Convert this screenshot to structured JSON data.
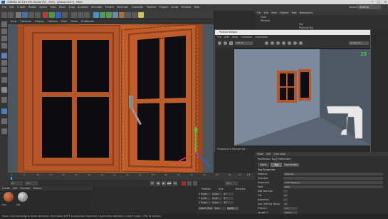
{
  "window": {
    "title": "CINEMA 4D R19.053 Studio (RC - R19) - [Szene.c4d *] - Main",
    "min": "—",
    "max": "▢",
    "close": "✕"
  },
  "menu": {
    "items": [
      "File",
      "Edit",
      "Create",
      "Modes",
      "Select",
      "Tools",
      "Mesh",
      "Snap",
      "Animate",
      "Simulate",
      "Tracker",
      "MoGraph",
      "Character",
      "Pipeline",
      "Plugins",
      "Script",
      "Window",
      "Help"
    ],
    "layout_label": "Layout:",
    "layout_value": "Startup"
  },
  "viewport_menu": [
    "View",
    "Cameras",
    "Display",
    "Options",
    "Filter",
    "Panel",
    "ProRender"
  ],
  "object_manager": {
    "menu": [
      "File",
      "Edit",
      "View",
      "Objects",
      "Tags",
      "Bookmarks"
    ],
    "objects": [
      "Floor",
      "Window",
      "Sky",
      "Physical Sky"
    ]
  },
  "picture_viewer": {
    "title": "Picture Viewer",
    "menu": [
      "File",
      "Edit",
      "View",
      "Compare",
      "Animation"
    ],
    "zoom": "100 %",
    "fps": "23",
    "mode": "ProRender",
    "status": "Progressive Rendering ..."
  },
  "attributes": {
    "menu": [
      "Mode",
      "Edit",
      "User Data"
    ],
    "header": "ProRender Tag [ProRender]",
    "tabs": [
      "Basic",
      "Tag",
      "Coordinates"
    ],
    "section": "Tag Properties",
    "rows": [
      {
        "label": "Material",
        "value": "Material"
      },
      {
        "label": "Selection",
        "value": ""
      },
      {
        "label": "Projection",
        "value": "UVW Mapping"
      },
      {
        "label": "Side",
        "value": "Both"
      },
      {
        "label": "Add Material",
        "value": ""
      },
      {
        "label": "Tile",
        "value": "✔"
      },
      {
        "label": "Seamless",
        "value": ""
      },
      {
        "label": "Use UVW for Bump",
        "value": "✔"
      },
      {
        "label": "Offset U",
        "value": "0 %"
      },
      {
        "label": "Length U",
        "value": "100 %"
      },
      {
        "label": "Tiles U",
        "value": "1"
      }
    ]
  },
  "timeline": {
    "ticks": [
      "0",
      "5",
      "10",
      "15",
      "20",
      "25",
      "30",
      "35",
      "40",
      "45",
      "50",
      "55",
      "60",
      "65",
      "70",
      "75",
      "80",
      "85",
      "90"
    ],
    "frame": "0 F",
    "end": "90 F"
  },
  "playback": {
    "start": "0 F",
    "current": "0 F",
    "end": "90 F",
    "buttons": [
      "⏮",
      "◀",
      "▶",
      "▶▶",
      "⏭"
    ]
  },
  "material_manager": {
    "menu": [
      "Create",
      "Edit",
      "Function",
      "Texture"
    ],
    "materials": [
      "Mat",
      "Mat"
    ]
  },
  "coordinates": {
    "headers": [
      "Position",
      "Size",
      "Rotation"
    ],
    "rows": [
      {
        "axis": "X",
        "pos": "0 cm",
        "size": "0 cm",
        "rot": "0 °"
      },
      {
        "axis": "Y",
        "pos": "0 cm",
        "size": "0 cm",
        "rot": "0 °"
      },
      {
        "axis": "Z",
        "pos": "0 cm",
        "size": "0 cm",
        "rot": "0 °"
      }
    ],
    "mode": "Object (Rel)",
    "size_mode": "Size",
    "apply": "Apply"
  },
  "status_bar": "Move: Click and drag to move elements. Hold down SHIFT to quantize movement / add to the selection in point mode, CTRL to remove."
}
